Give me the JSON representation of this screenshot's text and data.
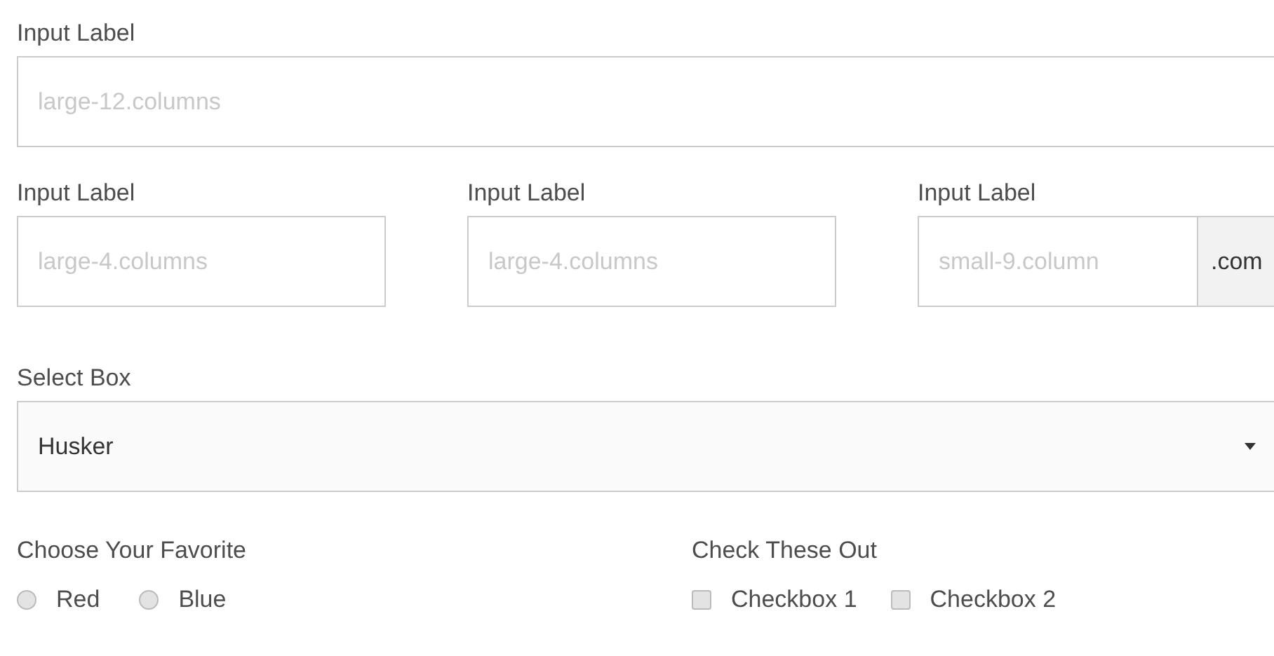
{
  "row1": [
    {
      "label": "Input Label",
      "placeholder": "large-12.columns"
    }
  ],
  "row2": [
    {
      "label": "Input Label",
      "placeholder": "large-4.columns"
    },
    {
      "label": "Input Label",
      "placeholder": "large-4.columns"
    },
    {
      "label": "Input Label",
      "placeholder": "small-9.column",
      "postfix": ".com"
    }
  ],
  "select": {
    "label": "Select Box",
    "value": "Husker"
  },
  "radios": {
    "label": "Choose Your Favorite",
    "options": [
      {
        "label": "Red",
        "selected": false
      },
      {
        "label": "Blue",
        "selected": false
      }
    ]
  },
  "checkboxes": {
    "label": "Check These Out",
    "options": [
      {
        "label": "Checkbox 1",
        "checked": false
      },
      {
        "label": "Checkbox 2",
        "checked": false
      }
    ]
  }
}
